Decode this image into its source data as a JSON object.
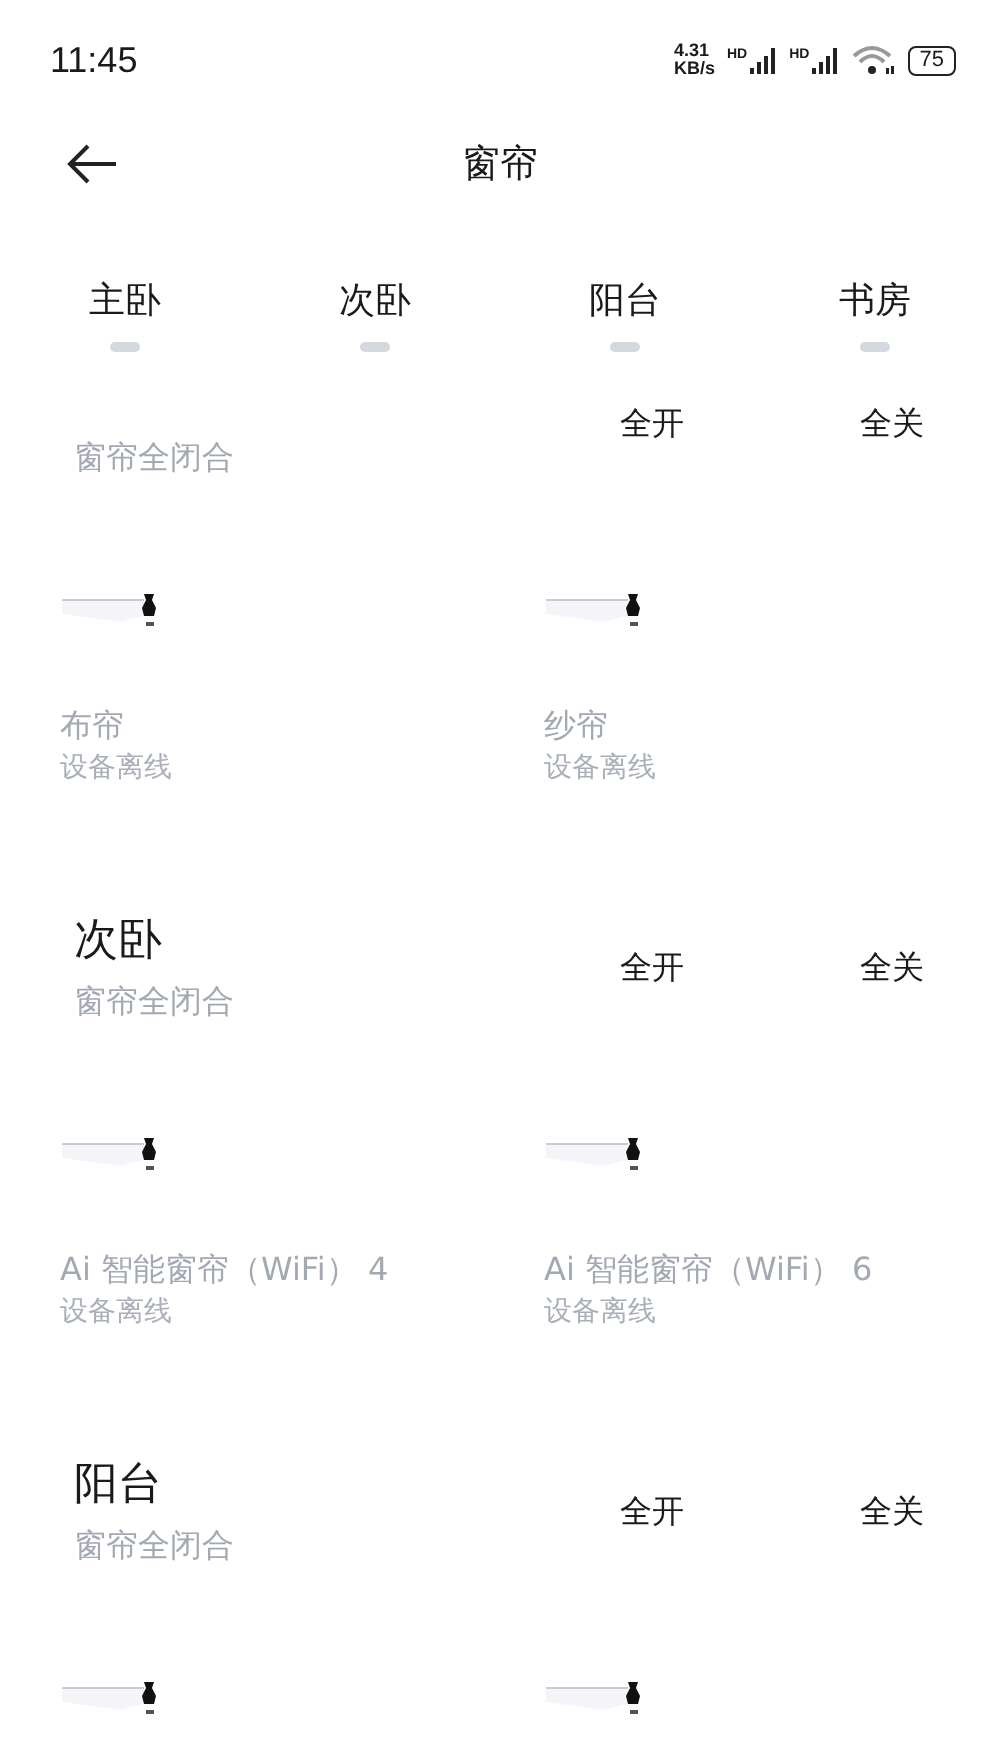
{
  "status_bar": {
    "time": "11:45",
    "speed_value": "4.31",
    "speed_unit": "KB/s",
    "sim_labels": [
      "HD",
      "HD"
    ],
    "battery": "75"
  },
  "header": {
    "title": "窗帘"
  },
  "tabs": [
    {
      "label": "主卧",
      "selected": false
    },
    {
      "label": "次卧",
      "selected": false
    },
    {
      "label": "阳台",
      "selected": false
    },
    {
      "label": "书房",
      "selected": false
    }
  ],
  "sections": [
    {
      "subtitle": "窗帘全闭合",
      "actions": [
        "全开",
        "全关"
      ],
      "devices": [
        {
          "kind": "curtain",
          "name": "布帘",
          "status": "设备离线"
        },
        {
          "kind": "curtain",
          "name": "纱帘",
          "status": "设备离线"
        }
      ]
    },
    {
      "title": "次卧",
      "subtitle": "窗帘全闭合",
      "actions": [
        "全开",
        "全关"
      ],
      "devices": [
        {
          "kind": "curtain",
          "name": "Ai 智能窗帘（WiFi） 4",
          "status": "设备离线"
        },
        {
          "kind": "curtain",
          "name": "Ai 智能窗帘（WiFi） 6",
          "status": "设备离线"
        }
      ]
    },
    {
      "title": "阳台",
      "subtitle": "窗帘全闭合",
      "actions": [
        "全开",
        "全关"
      ],
      "devices": [
        {
          "kind": "curtain"
        },
        {
          "kind": "curtain"
        }
      ]
    }
  ]
}
